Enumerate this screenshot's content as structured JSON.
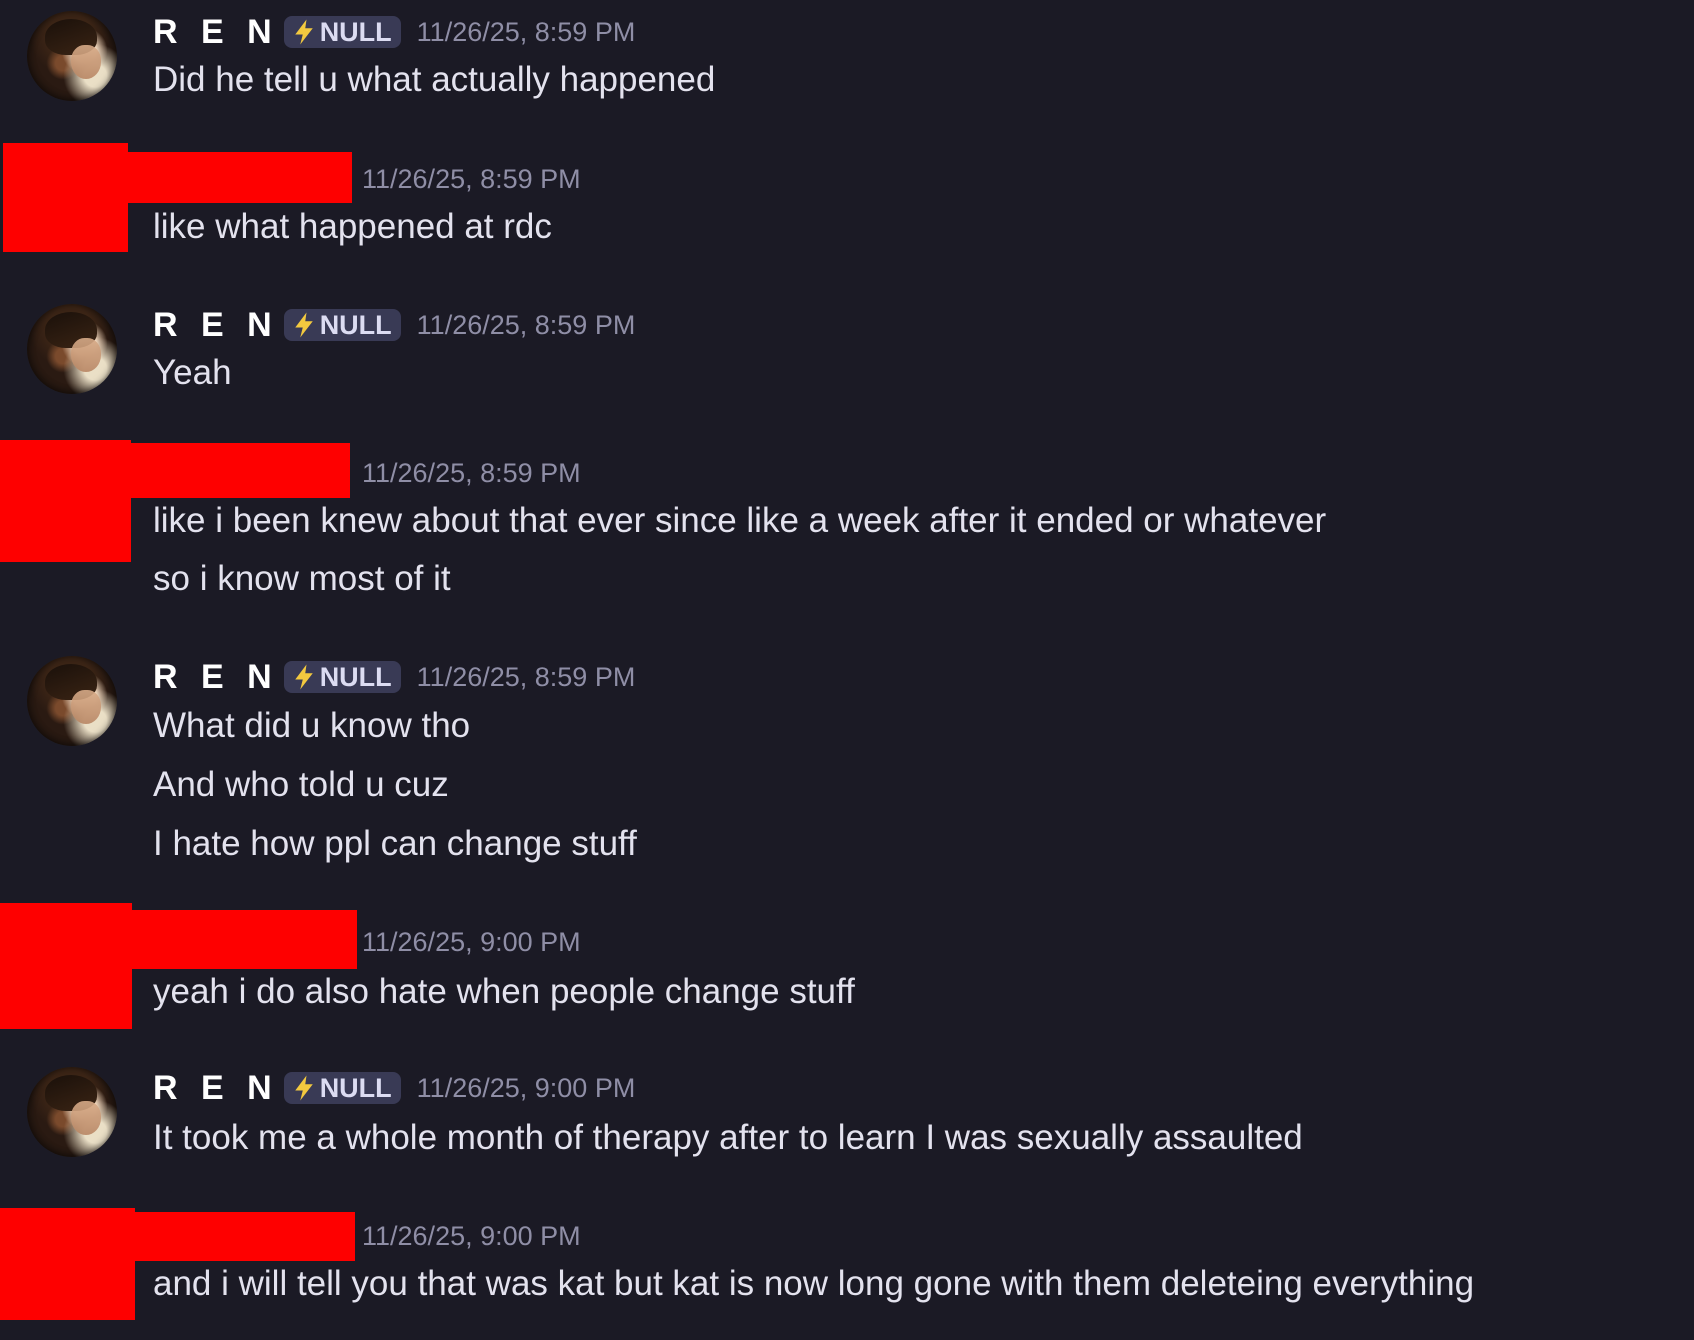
{
  "messages": [
    {
      "author": "R E N",
      "tag": "NULL",
      "timestamp": "11/26/25, 8:59 PM",
      "lines": [
        "Did he tell u what actually happened"
      ]
    },
    {
      "author": "",
      "timestamp": "11/26/25, 8:59 PM",
      "lines": [
        "like what happened at rdc"
      ]
    },
    {
      "author": "R E N",
      "tag": "NULL",
      "timestamp": "11/26/25, 8:59 PM",
      "lines": [
        "Yeah"
      ]
    },
    {
      "author": "",
      "timestamp": "11/26/25, 8:59 PM",
      "lines": [
        "like i been knew about that ever since like a week after it ended or whatever",
        "so i know most of it"
      ]
    },
    {
      "author": "R E N",
      "tag": "NULL",
      "timestamp": "11/26/25, 8:59 PM",
      "lines": [
        "What did u know tho",
        "And who told u cuz",
        "I hate how ppl can change stuff"
      ]
    },
    {
      "author": "",
      "timestamp": "11/26/25, 9:00 PM",
      "lines": [
        "yeah i do also hate when people change stuff"
      ]
    },
    {
      "author": "R E N",
      "tag": "NULL",
      "timestamp": "11/26/25, 9:00 PM",
      "lines": [
        "It took me a whole month of therapy after to learn I was sexually assaulted"
      ]
    },
    {
      "author": "",
      "timestamp": "11/26/25, 9:00 PM",
      "lines": [
        "and i will tell you that was kat but kat is now long gone with them deleteing everything"
      ]
    }
  ],
  "colors": {
    "background": "#1b1a25",
    "redaction": "#fe0000",
    "tag_background": "#393a55",
    "bolt": "#f3c93f"
  },
  "icons": {
    "tag_icon": "lightning-bolt-icon"
  }
}
